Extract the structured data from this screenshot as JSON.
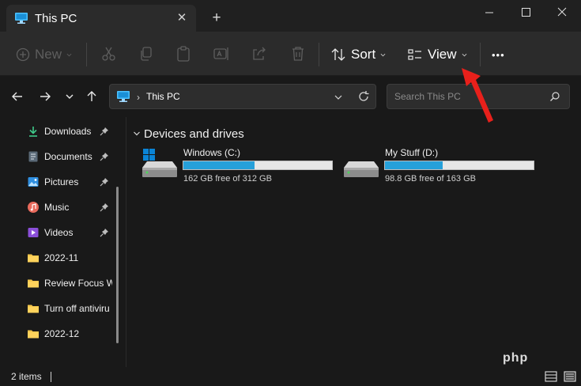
{
  "window": {
    "tab_title": "This PC",
    "close_tab": "✕",
    "new_tab": "+"
  },
  "commandbar": {
    "new_label": "New",
    "sort_label": "Sort",
    "view_label": "View",
    "more_label": "•••"
  },
  "address": {
    "separator": "›",
    "location": "This PC",
    "search_placeholder": "Search This PC"
  },
  "navigation": {
    "items": [
      {
        "label": "Downloads",
        "icon": "download-icon",
        "pinned": true
      },
      {
        "label": "Documents",
        "icon": "document-icon",
        "pinned": true
      },
      {
        "label": "Pictures",
        "icon": "pictures-icon",
        "pinned": true
      },
      {
        "label": "Music",
        "icon": "music-icon",
        "pinned": true
      },
      {
        "label": "Videos",
        "icon": "videos-icon",
        "pinned": true
      },
      {
        "label": "2022-11",
        "icon": "folder-icon",
        "pinned": false
      },
      {
        "label": "Review Focus W",
        "icon": "folder-icon",
        "pinned": false
      },
      {
        "label": "Turn off antiviru",
        "icon": "folder-icon",
        "pinned": false
      },
      {
        "label": "2022-12",
        "icon": "folder-icon",
        "pinned": false
      }
    ]
  },
  "content": {
    "group_title": "Devices and drives",
    "drives": [
      {
        "name": "Windows (C:)",
        "free_text": "162 GB free of 312 GB",
        "used_fraction": 0.48
      },
      {
        "name": "My Stuff (D:)",
        "free_text": "98.8 GB free of 163 GB",
        "used_fraction": 0.39
      }
    ]
  },
  "status": {
    "items_count": "2 items"
  },
  "overlay": {
    "watermark": "php"
  },
  "colors": {
    "accent": "#26a0da",
    "annotation_arrow": "#e8201b",
    "folder": "#f4c64b"
  }
}
